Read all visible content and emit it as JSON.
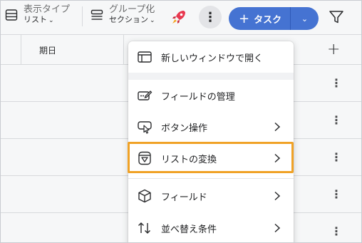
{
  "toolbar": {
    "view": {
      "label": "表示タイプ",
      "value": "リスト"
    },
    "group": {
      "label": "グループ化",
      "value": "セクション"
    },
    "more_icon": "vertical-ellipsis",
    "task_button": {
      "plus": "+",
      "label": "タスク"
    },
    "filter_icon": "funnel"
  },
  "table": {
    "column_header": "期日",
    "add_column": "+",
    "row_menu": "⋮"
  },
  "menu": {
    "items": [
      {
        "label": "新しいウィンドウで開く",
        "icon": "window-icon"
      },
      {
        "label": "フィールドの管理",
        "icon": "edit-field-icon"
      },
      {
        "label": "ボタン操作",
        "icon": "button-click-icon"
      },
      {
        "label": "リストの変換",
        "icon": "convert-icon"
      },
      {
        "label": "フィールド",
        "icon": "cube-icon"
      },
      {
        "label": "並べ替え条件",
        "icon": "sort-icon"
      }
    ]
  },
  "colors": {
    "accent": "#4573d2",
    "highlight": "#f0a226",
    "rocket": "#e8384f"
  }
}
